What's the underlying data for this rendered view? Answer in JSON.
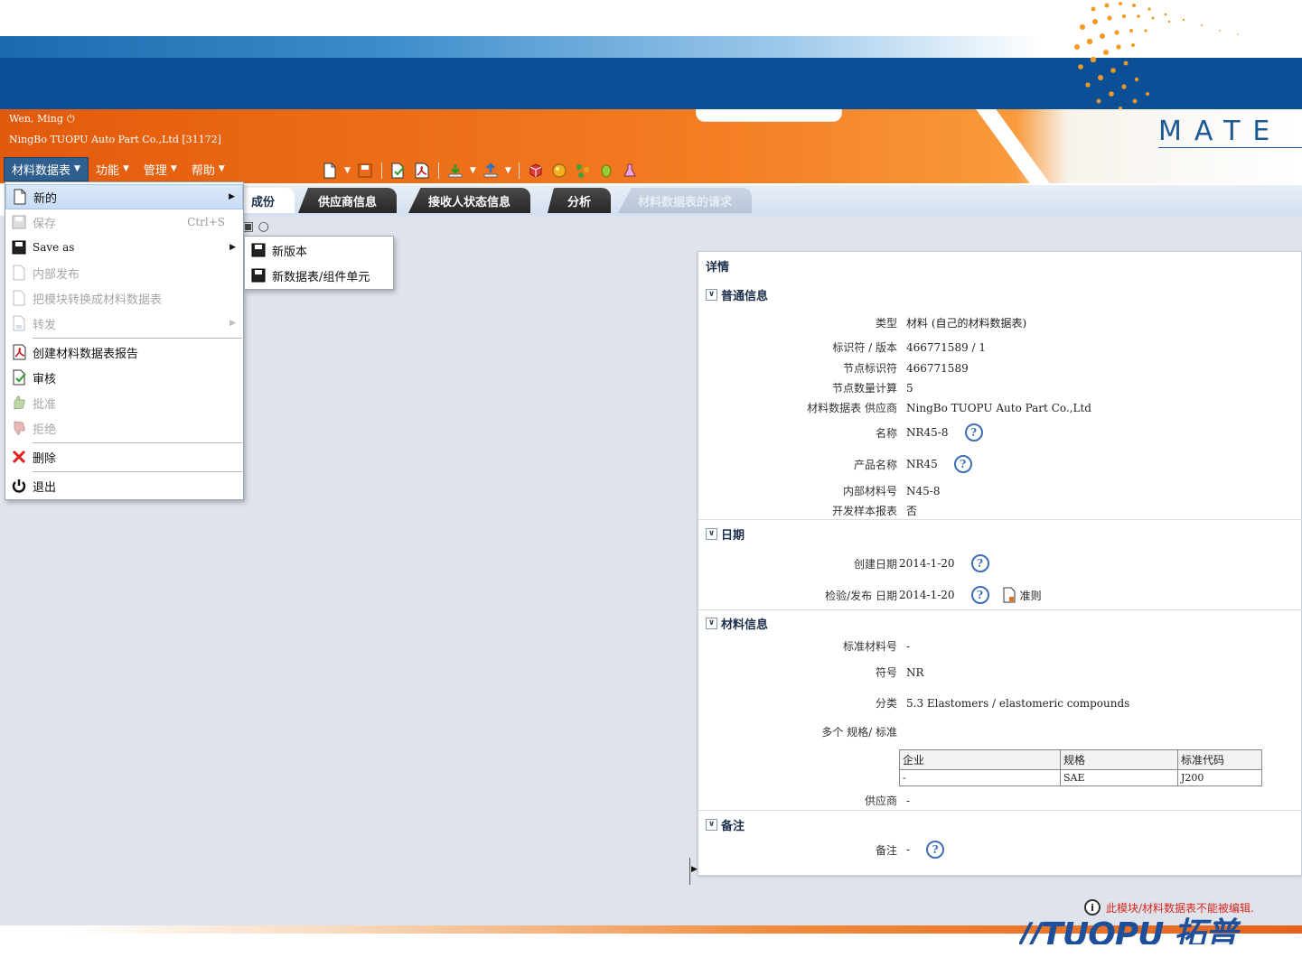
{
  "header": {
    "user": "Wen, Ming",
    "company": "NingBo TUOPU Auto Part Co.,Ltd [31172]",
    "brand": "MATE"
  },
  "menubar": [
    {
      "label": "材料数据表"
    },
    {
      "label": "功能"
    },
    {
      "label": "管理"
    },
    {
      "label": "帮助"
    }
  ],
  "tabs": [
    {
      "label": "成份"
    },
    {
      "label": "供应商信息"
    },
    {
      "label": "接收人状态信息"
    },
    {
      "label": "分析"
    },
    {
      "label": "材料数据表的请求"
    }
  ],
  "dropdown": {
    "items": [
      {
        "label": "新的"
      },
      {
        "label": "保存",
        "shortcut": "Ctrl+S"
      },
      {
        "label": "Save as"
      },
      {
        "label": "内部发布"
      },
      {
        "label": "把模块转换成材料数据表"
      },
      {
        "label": "转发"
      },
      {
        "label": "创建材料数据表报告"
      },
      {
        "label": "审核"
      },
      {
        "label": "批准"
      },
      {
        "label": "拒绝"
      },
      {
        "label": "删除"
      },
      {
        "label": "退出"
      }
    ],
    "submenu": [
      {
        "label": "新版本"
      },
      {
        "label": "新数据表/组件单元"
      }
    ]
  },
  "details": {
    "title": "详情",
    "general": {
      "heading": "普通信息",
      "rows": [
        {
          "label": "类型",
          "value": "材料 (自己的材料数据表)"
        },
        {
          "label": "标识符 / 版本",
          "value": "466771589 / 1"
        },
        {
          "label": "节点标识符",
          "value": "466771589"
        },
        {
          "label": "节点数量计算",
          "value": "5"
        },
        {
          "label": "材料数据表 供应商",
          "value": "NingBo TUOPU Auto Part Co.,Ltd"
        },
        {
          "label": "名称",
          "value": "NR45-8"
        },
        {
          "label": "产品名称",
          "value": "NR45"
        },
        {
          "label": "内部材料号",
          "value": "N45-8"
        },
        {
          "label": "开发样本报表",
          "value": "否"
        }
      ]
    },
    "dates": {
      "heading": "日期",
      "rows": [
        {
          "label": "创建日期",
          "value": "2014-1-20"
        },
        {
          "label": "检验/发布 日期",
          "value": "2014-1-20",
          "link": "准则"
        }
      ]
    },
    "material": {
      "heading": "材料信息",
      "rows": [
        {
          "label": "标准材料号",
          "value": "-"
        },
        {
          "label": "符号",
          "value": "NR"
        },
        {
          "label": "分类",
          "value": "5.3 Elastomers / elastomeric compounds"
        },
        {
          "label": "多个 规格/ 标准",
          "value": ""
        },
        {
          "label": "供应商",
          "value": "-"
        }
      ],
      "table": {
        "headers": [
          "企业",
          "规格",
          "标准代码"
        ],
        "rows": [
          [
            "-",
            "SAE",
            "J200"
          ]
        ]
      }
    },
    "notes": {
      "heading": "备注",
      "rows": [
        {
          "label": "备注",
          "value": "-"
        }
      ]
    }
  },
  "status": {
    "message": "此模块/材料数据表不能被编辑."
  },
  "colors": {
    "blue_band": "#0b4f97",
    "orange": "#f47d22",
    "status_red": "#d9261c"
  }
}
